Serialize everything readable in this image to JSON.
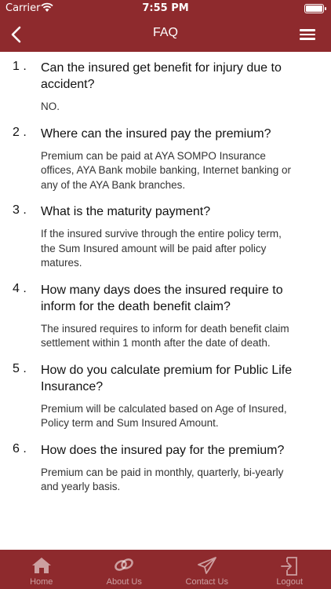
{
  "status_bar": {
    "carrier": "Carrier",
    "time": "7:55 PM"
  },
  "header": {
    "title": "FAQ",
    "back_icon": "chevron-left-icon",
    "menu_icon": "hamburger-menu-icon"
  },
  "faqs": [
    {
      "num": "1 .",
      "question": "Can the insured get benefit for injury due to accident?",
      "answer": "NO."
    },
    {
      "num": "2 .",
      "question": "Where can the insured pay the premium?",
      "answer": "Premium can be paid at AYA SOMPO Insurance offices, AYA Bank mobile banking, Internet banking or any of the AYA Bank branches."
    },
    {
      "num": "3 .",
      "question": "What is the maturity payment?",
      "answer": "If the insured survive through the entire policy term, the Sum Insured amount will be paid after policy matures."
    },
    {
      "num": "4 .",
      "question": "How many days does the insured require to inform for the death benefit claim?",
      "answer": "The insured requires to inform for death benefit claim settlement within 1 month after the date of death."
    },
    {
      "num": "5 .",
      "question": "How do you calculate premium for Public Life Insurance?",
      "answer": "Premium will be calculated based on Age of Insured, Policy term and Sum Insured Amount."
    },
    {
      "num": "6 .",
      "question": "How does the insured pay for the premium?",
      "answer": "Premium can be paid in monthly, quarterly, bi-yearly and yearly basis."
    }
  ],
  "tabbar": {
    "tabs": [
      {
        "label": "Home",
        "icon": "home-icon"
      },
      {
        "label": "About Us",
        "icon": "link-icon"
      },
      {
        "label": "Contact Us",
        "icon": "paper-plane-icon"
      },
      {
        "label": "Logout",
        "icon": "logout-icon"
      }
    ]
  },
  "colors": {
    "brand": "#8e2a2d",
    "text": "#111111",
    "answer_text": "#333333"
  }
}
